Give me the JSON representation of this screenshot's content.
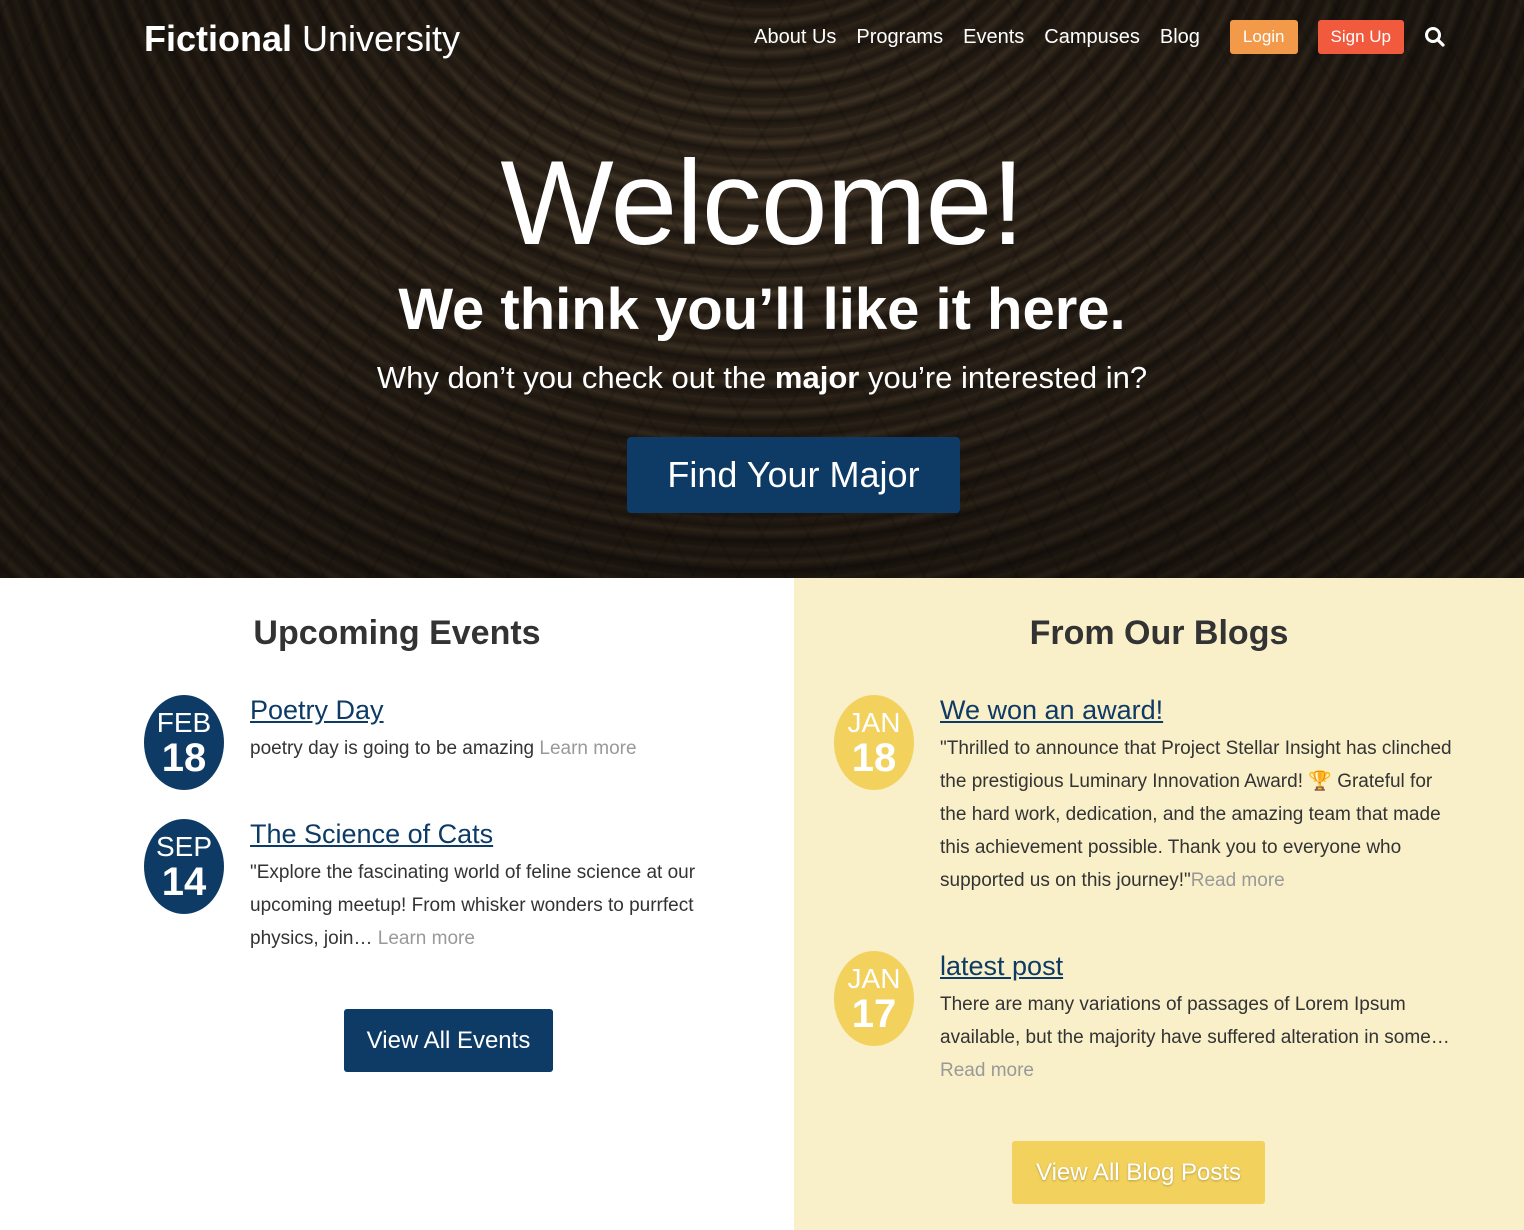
{
  "header": {
    "logo_bold": "Fictional",
    "logo_light": "University",
    "nav": [
      "About Us",
      "Programs",
      "Events",
      "Campuses",
      "Blog"
    ],
    "login_label": "Login",
    "signup_label": "Sign Up",
    "search_icon": "search-icon"
  },
  "hero": {
    "heading": "Welcome!",
    "tagline": "We think you’ll like it here.",
    "sub_before": "Why don’t you check out the ",
    "sub_bold": "major",
    "sub_after": " you’re interested in?",
    "button": "Find Your Major"
  },
  "events": {
    "title": "Upcoming Events",
    "items": [
      {
        "month": "FEB",
        "day": "18",
        "title": "Poetry Day",
        "body": "poetry day is going to be amazing ",
        "more": "Learn more"
      },
      {
        "month": "SEP",
        "day": "14",
        "title": "The Science of Cats",
        "body": "\"Explore the fascinating world of feline science at our upcoming meetup! From whisker wonders to purrfect physics, join… ",
        "more": "Learn more"
      }
    ],
    "button": "View All Events"
  },
  "blogs": {
    "title": "From Our Blogs",
    "items": [
      {
        "month": "JAN",
        "day": "18",
        "title": "We won an award!",
        "body": "\"Thrilled to announce that Project Stellar Insight has clinched the prestigious Luminary Innovation Award! 🏆 Grateful for the hard work, dedication, and the amazing team that made this achievement possible. Thank you to everyone who supported us on this journey!\"",
        "more": "Read more"
      },
      {
        "month": "JAN",
        "day": "17",
        "title": "latest post",
        "body": "There are many variations of passages of Lorem Ipsum available, but the majority have suffered alteration in some…",
        "more": "Read more"
      }
    ],
    "button": "View All Blog Posts"
  },
  "colors": {
    "navy": "#0d3b66",
    "orange": "#f2994a",
    "red": "#f15a3c",
    "yellow": "#f2d15c",
    "cream": "#f9efc8"
  }
}
